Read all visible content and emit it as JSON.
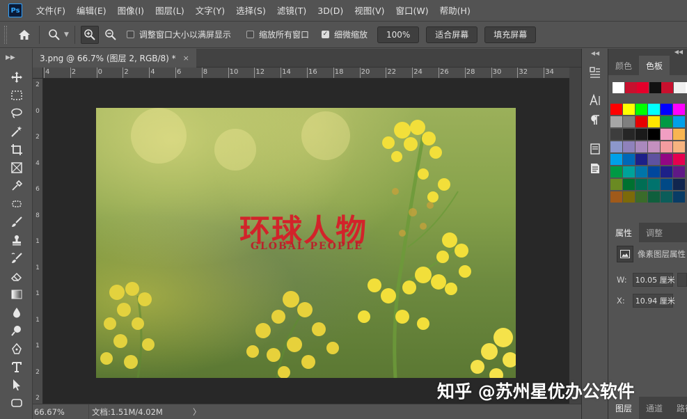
{
  "app": {
    "logo_text": "Ps",
    "menu": [
      "文件(F)",
      "编辑(E)",
      "图像(I)",
      "图层(L)",
      "文字(Y)",
      "选择(S)",
      "滤镜(T)",
      "3D(D)",
      "视图(V)",
      "窗口(W)",
      "帮助(H)"
    ]
  },
  "options": {
    "resize_windows_label": "调整窗口大小以满屏显示",
    "resize_windows_checked": false,
    "zoom_all_label": "缩放所有窗口",
    "zoom_all_checked": false,
    "scrubby_label": "细微缩放",
    "scrubby_checked": true,
    "zoom_value": "100%",
    "fit_screen_label": "适合屏幕",
    "fill_screen_label": "填充屏幕"
  },
  "document": {
    "tab_title": "3.png @ 66.7% (图层 2, RGB/8) *",
    "close_glyph": "×",
    "ruler_top": [
      "4",
      "2",
      "0",
      "2",
      "4",
      "6",
      "8",
      "10",
      "12",
      "14",
      "16",
      "18",
      "20",
      "22",
      "24",
      "26",
      "28",
      "30",
      "32",
      "34"
    ],
    "ruler_left": [
      "2",
      "0",
      "2",
      "4",
      "6",
      "8",
      "1",
      "1",
      "1",
      "1",
      "1",
      "2",
      "2"
    ],
    "logo_cn": "环球人物",
    "logo_en": "GLOBAL PEOPLE"
  },
  "status": {
    "zoom": "66.67%",
    "doc_info": "文档:1.51M/4.02M",
    "more_glyph": "〉"
  },
  "panels": {
    "top_tabs": [
      "颜色",
      "色板"
    ],
    "top_active": 1,
    "prop_tabs": [
      "属性",
      "调整"
    ],
    "prop_active": 0,
    "prop_header": "像素图层属性",
    "w_label": "W:",
    "w_value": "10.05 厘米",
    "x_label": "X:",
    "x_value": "10.94 厘米",
    "bottom_tabs": [
      "图层",
      "通道",
      "路径"
    ],
    "bottom_active": 0
  },
  "swatches": {
    "top_row": [
      "#ffffff",
      "#c8102e",
      "#e4002b",
      "#111111",
      "#c8102e",
      "#f0f0f0",
      "#ffffff"
    ],
    "grid": [
      [
        "#ff0000",
        "#ffff00",
        "#00ff00",
        "#00ffff",
        "#0000ff",
        "#ff00ff"
      ],
      [
        "#a6a6a6",
        "#7f7f7f",
        "#e60000",
        "#ffe600",
        "#009944",
        "#00a0e9"
      ],
      [
        "#3d3d3d",
        "#262626",
        "#1a1a1a",
        "#000000",
        "#f19ec2",
        "#f8b551"
      ],
      [
        "#8c97cb",
        "#8f82bc",
        "#aa89bd",
        "#c490bf",
        "#f29c9f",
        "#f6b37f"
      ],
      [
        "#00a0e9",
        "#0068b7",
        "#1d2088",
        "#5f52a0",
        "#920783",
        "#e5004f"
      ],
      [
        "#009944",
        "#00a29a",
        "#0075a9",
        "#00479d",
        "#1d2088",
        "#601986"
      ],
      [
        "#6a8a22",
        "#007130",
        "#006e54",
        "#00736d",
        "#004986",
        "#11264f"
      ],
      [
        "#a05a1a",
        "#7c6a0a",
        "#3b6b2a",
        "#105f3d",
        "#0c5d5a",
        "#093c66"
      ]
    ]
  },
  "watermark": "知乎 @苏州星优办公软件"
}
